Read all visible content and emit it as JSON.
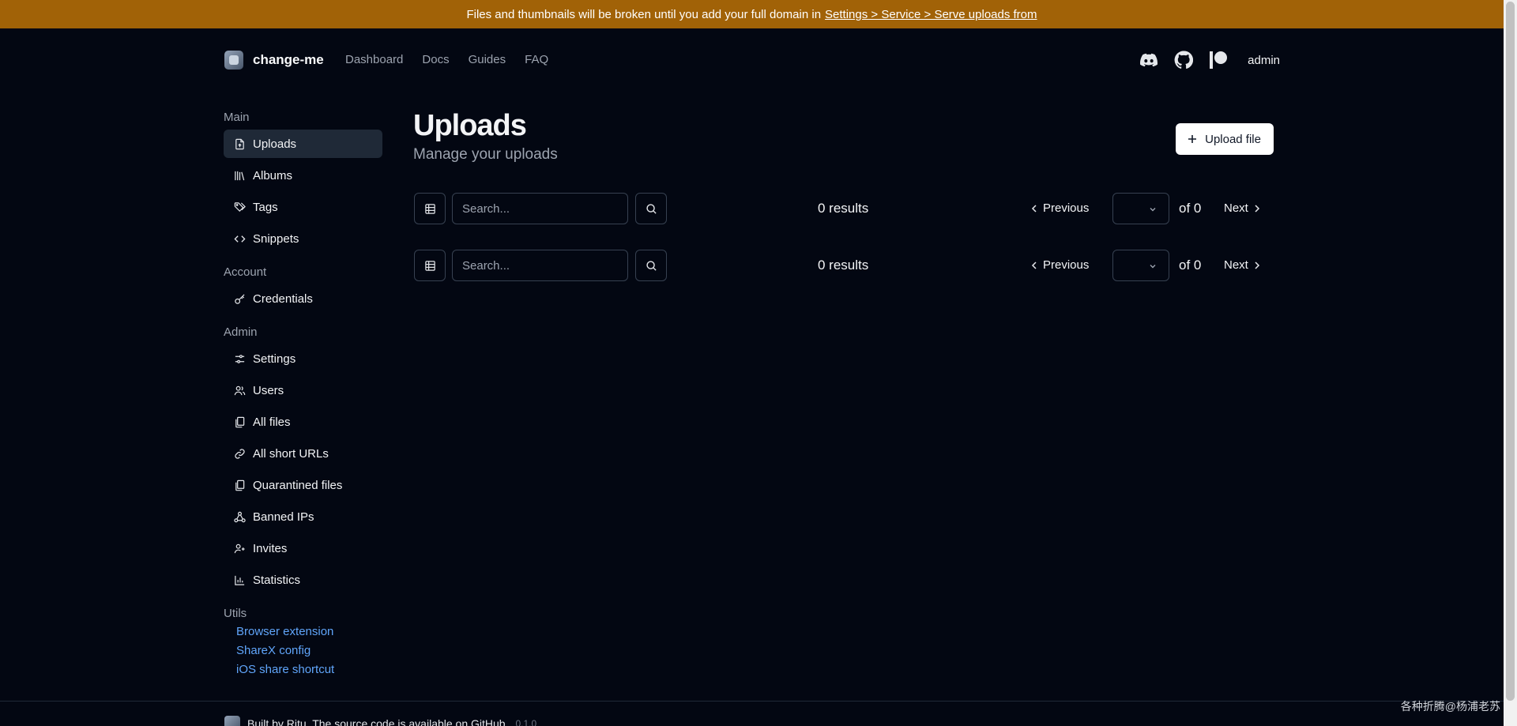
{
  "banner": {
    "text": "Files and thumbnails will be broken until you add your full domain in",
    "link": "Settings > Service > Serve uploads from"
  },
  "header": {
    "brand": "change-me",
    "nav": [
      "Dashboard",
      "Docs",
      "Guides",
      "FAQ"
    ],
    "icons": [
      "discord-icon",
      "github-icon",
      "patreon-icon"
    ],
    "user": "admin"
  },
  "sidebar": {
    "main_title": "Main",
    "main_items": [
      {
        "label": "Uploads",
        "icon": "file-upload-icon",
        "active": true
      },
      {
        "label": "Albums",
        "icon": "library-icon"
      },
      {
        "label": "Tags",
        "icon": "tags-icon"
      },
      {
        "label": "Snippets",
        "icon": "code-icon"
      }
    ],
    "account_title": "Account",
    "account_items": [
      {
        "label": "Credentials",
        "icon": "key-icon"
      }
    ],
    "admin_title": "Admin",
    "admin_items": [
      {
        "label": "Settings",
        "icon": "settings-icon"
      },
      {
        "label": "Users",
        "icon": "users-icon"
      },
      {
        "label": "All files",
        "icon": "files-icon"
      },
      {
        "label": "All short URLs",
        "icon": "link-icon"
      },
      {
        "label": "Quarantined files",
        "icon": "files-icon"
      },
      {
        "label": "Banned IPs",
        "icon": "network-icon"
      },
      {
        "label": "Invites",
        "icon": "user-plus-icon"
      },
      {
        "label": "Statistics",
        "icon": "bar-chart-icon"
      }
    ],
    "utils_title": "Utils",
    "utils_links": [
      "Browser extension",
      "ShareX config",
      "iOS share shortcut"
    ]
  },
  "main": {
    "title": "Uploads",
    "subtitle": "Manage your uploads",
    "upload_button": "Upload file"
  },
  "toolbars": [
    {
      "search_placeholder": "Search...",
      "results": "0 results",
      "prev": "Previous",
      "of": "of 0",
      "next": "Next"
    },
    {
      "search_placeholder": "Search...",
      "results": "0 results",
      "prev": "Previous",
      "of": "of 0",
      "next": "Next"
    }
  ],
  "footer": {
    "text": "Built by Ritu. The source code is available on GitHub.",
    "version": "0.1.0"
  },
  "watermark": "各种折腾@杨浦老苏"
}
